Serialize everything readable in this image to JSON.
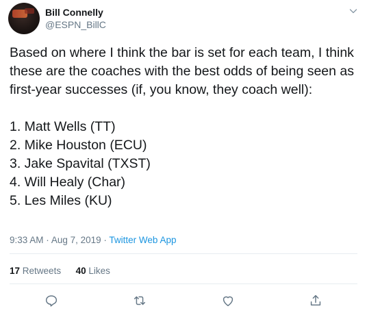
{
  "tweet": {
    "author": {
      "display_name": "Bill Connelly",
      "handle": "@ESPN_BillC"
    },
    "text": "Based on where I think the bar is set for each team, I think these are the coaches with the best odds of being seen as first-year successes (if, you know, they coach well):\n\n1. Matt Wells (TT)\n2. Mike Houston (ECU)\n3. Jake Spavital (TXST)\n4. Will Healy (Char)\n5. Les Miles (KU)",
    "time": "9:33 AM",
    "separator": "·",
    "date": "Aug 7, 2019",
    "source": "Twitter Web App",
    "stats": {
      "retweets_count": "17",
      "retweets_label": "Retweets",
      "likes_count": "40",
      "likes_label": "Likes"
    }
  },
  "icons": {
    "caret": "chevron-down-icon",
    "reply": "reply-icon",
    "retweet": "retweet-icon",
    "like": "heart-icon",
    "share": "share-icon"
  },
  "colors": {
    "text": "#14171a",
    "secondary": "#657786",
    "link": "#1b95e0",
    "divider": "#e6ecf0"
  }
}
